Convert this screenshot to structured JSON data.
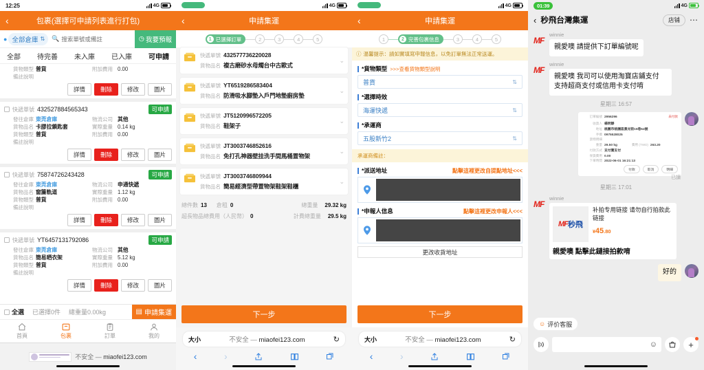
{
  "panel1": {
    "status": {
      "time": "12:25",
      "network": "4G"
    },
    "nav": {
      "back": "‹",
      "title": "包裹(選擇可申請列表進行打包)"
    },
    "search": {
      "warehouse": "全部倉庫",
      "placeholder": "搜索單號或備註",
      "forecast_label": "我要預報"
    },
    "tabs": [
      "全部",
      "待完善",
      "未入庫",
      "已入庫",
      "可申請"
    ],
    "labels": {
      "tracking": "快遞單號",
      "warehouse": "發往倉庫",
      "logistics": "物流公司",
      "goods_name": "貨物品名",
      "actual_weight": "實際重量",
      "goods_type": "貨物類型",
      "extra_fee": "附加費用",
      "remark": "備註說明"
    },
    "partial_top": {
      "goods_type": "普貨",
      "extra_fee": "0.00"
    },
    "buttons": {
      "detail": "詳情",
      "delete": "刪除",
      "modify": "修改",
      "image": "圖片"
    },
    "badge_applicable": "可申請",
    "packages": [
      {
        "tracking": "432527884565343",
        "warehouse": "東莞倉庫",
        "logistics": "其他",
        "goods_name": "卡膠拉鎖匙套",
        "actual_weight": "0.14 kg",
        "goods_type": "普貨",
        "extra_fee": "0.00"
      },
      {
        "tracking": "75874726243428",
        "warehouse": "東莞倉庫",
        "logistics": "申通快遞",
        "goods_name": "窗簾軌道",
        "actual_weight": "1.12 kg",
        "goods_type": "普貨",
        "extra_fee": "0.00"
      },
      {
        "tracking": "YT6457131792086",
        "warehouse": "東莞倉庫",
        "logistics": "其他",
        "goods_name": "簡易晒衣架",
        "actual_weight": "5.12 kg",
        "goods_type": "普貨",
        "extra_fee": "0.00"
      }
    ],
    "selbar": {
      "select_all": "全選",
      "selected_text": "已選擇0件",
      "total_weight_text": "總重量0.00kg",
      "apply_label": "申請集運"
    },
    "tabbar": [
      {
        "label": "首頁",
        "icon": "home-icon"
      },
      {
        "label": "包裹",
        "icon": "box-icon"
      },
      {
        "label": "訂單",
        "icon": "clipboard-icon"
      },
      {
        "label": "我的",
        "icon": "person-icon"
      }
    ],
    "safari": {
      "insecure": "不安全",
      "dash": "—",
      "domain": "miaofei123.com"
    }
  },
  "panel2": {
    "status": {
      "time": "",
      "network": "4G"
    },
    "nav": {
      "back": "‹",
      "title": "申請集運"
    },
    "stepper": {
      "active_num": "1",
      "active_label": "已選擇訂單",
      "dots": [
        "2",
        "3",
        "4",
        "5"
      ]
    },
    "labels": {
      "tracking": "快遞單號",
      "goods_name": "貨物品名"
    },
    "shipments": [
      {
        "tracking": "432577736220028",
        "goods_name": "複古磨砂水母燭台中古歐式"
      },
      {
        "tracking": "YT6519286583404",
        "goods_name": "防滑吸水腳墊入戶門地墊廚房墊"
      },
      {
        "tracking": "JT5120996572205",
        "goods_name": "鞋架子"
      },
      {
        "tracking": "JT3003746852616",
        "goods_name": "免打孔神器壁挂洗手間馬桶置物架"
      },
      {
        "tracking": "JT3003746809944",
        "goods_name": "簡易經濟型帶置物架鞋架鞋櫃"
      }
    ],
    "totals": {
      "count_label": "總件數",
      "count_value": "13",
      "storage_label": "倉租",
      "storage_value": "0",
      "weight_label": "總重量",
      "weight_value": "29.32 kg",
      "oversize_label": "超長物品總費用（人民幣）",
      "oversize_value": "0",
      "billable_label": "計費總重量",
      "billable_value": "29.5 kg"
    },
    "next_label": "下一步",
    "safari": {
      "aa": "大小",
      "insecure": "不安全",
      "dash": "—",
      "domain": "miaofei123.com"
    }
  },
  "panel3": {
    "status": {
      "time": "",
      "network": "4G"
    },
    "nav": {
      "back": "‹",
      "title": "申請集運"
    },
    "stepper": {
      "active_num": "2",
      "active_label": "完善包裹信息",
      "dot_before": "1",
      "dots": [
        "3",
        "4",
        "5"
      ]
    },
    "tip": "温馨提示：請如實填寫申報信息，以免訂單無法正常送運。",
    "fields": {
      "goods_type_label": "*貨物類型",
      "goods_type_hint": ">>>查看貨物類型說明",
      "goods_type_value": "普貨",
      "timeliness_label": "*選擇時效",
      "timeliness_value": "海運快遞",
      "carrier_label": "*承運商",
      "carrier_value": "五股新竹2",
      "carrier_note": "承運商備註：",
      "ship_addr_label": "*派送地址",
      "ship_addr_hint": "點擊這裡更改自提點地址<<<",
      "declarer_label": "*申報人信息",
      "declarer_hint": "點擊這裡更改申報人<<<",
      "change_addr_label": "更改收貨地址"
    },
    "next_label": "下一步",
    "safari": {
      "aa": "大小",
      "insecure": "不安全",
      "dash": "—",
      "domain": "miaofei123.com"
    }
  },
  "panel4": {
    "status": {
      "time": "01:39",
      "network": "4G"
    },
    "nav": {
      "back": "‹",
      "title": "秒飛台灣集運",
      "shop": "店铺",
      "more": "⋯"
    },
    "messages": [
      {
        "sender": "winnie",
        "text": "親愛噢  請提供下訂單編號呢"
      },
      {
        "sender": "winnie",
        "text": "親愛噢 我司可以使用淘寶店鋪支付 支持超商支付或信用卡支付唷"
      }
    ],
    "timestamp1": "星期三 16:57",
    "order_card": {
      "id_label": "訂單編號",
      "id_value": "2956296",
      "status": "未付款",
      "recipient_label": "收貨人",
      "recipient_value": "楊明靜",
      "addr_label": "地址",
      "addr_value": "桃園市桃園區景光街15巷64號",
      "phone_label": "手機",
      "phone_value": "0975528025",
      "detail_label": "貨物明細",
      "weight_label": "重量",
      "weight_value": "29.50 kg",
      "fee_label": "費用 (TWD)",
      "fee_value": "263.20",
      "pay_label": "付款方式",
      "pay_value": "支付寶支付",
      "insure_label": "保貨費用",
      "insure_value": "0.00",
      "time_label": "下單時間",
      "time_value": "2022-06-01 16:21:13",
      "buttons": [
        "付款",
        "取消",
        "明細"
      ]
    },
    "read_mark": "已讀",
    "timestamp2": "星期三 17:01",
    "product": {
      "sender": "winnie",
      "brand_mf": "MF",
      "brand_cn": "秒飛",
      "title": "补拍专用链接 请勿自行拍款此链接",
      "currency": "¥",
      "price": "45",
      "decimal": ".80",
      "note": "親愛噢 點擊此鏈接拍款唷"
    },
    "my_reply": "好的",
    "eval_chip": "评价客服",
    "input_placeholder": ""
  },
  "colors": {
    "orange": "#f3761a",
    "green": "#45b97c",
    "red": "#e8211c",
    "blue": "#3d7fd6",
    "badge_green": "#27a844"
  }
}
